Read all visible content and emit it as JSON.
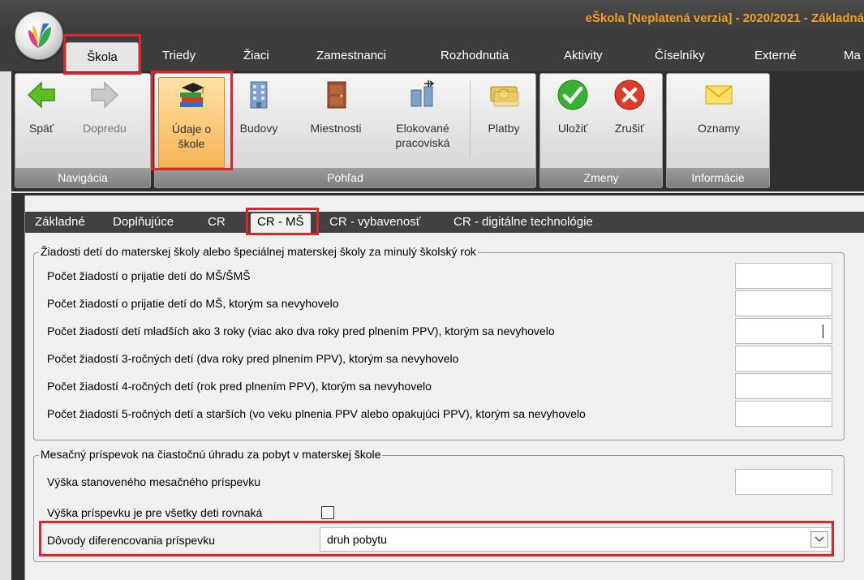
{
  "window": {
    "title": "eŠkola [Neplatená verzia] - 2020/2021 - Základná"
  },
  "ribbon_tabs": [
    "Škola",
    "Triedy",
    "Žiaci",
    "Zamestnanci",
    "Rozhodnutia",
    "Aktivity",
    "Číselníky",
    "Externé",
    "Ma"
  ],
  "ribbon": {
    "navigacia": {
      "label": "Navigácia",
      "back": "Späť",
      "forward": "Dopredu"
    },
    "pohlad": {
      "label": "Pohľad",
      "udaje_line1": "Údaje o",
      "udaje_line2": "škole",
      "budovy": "Budovy",
      "miestnosti": "Miestnosti",
      "elokovane_line1": "Elokované",
      "elokovane_line2": "pracoviská",
      "platby": "Platby"
    },
    "zmeny": {
      "label": "Zmeny",
      "save": "Uložiť",
      "cancel": "Zrušiť"
    },
    "informacie": {
      "label": "Informácie",
      "oznamy": "Oznamy"
    }
  },
  "subtabs": [
    "Základné",
    "Doplňujúce",
    "CR",
    "CR - MŠ",
    "CR - vybavenosť",
    "CR - digitálne technológie"
  ],
  "section1": {
    "legend": "Žiadosti detí do materskej školy alebo špeciálnej materskej školy za minulý školský rok",
    "rows": [
      "Počet žiadostí o prijatie detí do MŠ/ŠMŠ",
      "Počet žiadostí o prijatie detí do MŠ, ktorým sa nevyhovelo",
      "Počet žiadostí detí mladších ako 3 roky (viac ako dva roky pred plnením PPV), ktorým sa nevyhovelo",
      "Počet žiadostí 3-ročných detí (dva roky pred plnením PPV), ktorým sa nevyhovelo",
      "Počet žiadostí 4-ročných detí (rok pred plnením PPV), ktorým sa nevyhovelo",
      "Počet žiadostí 5-ročných detí a starších (vo veku plnenia PPV alebo opakujúci PPV), ktorým sa nevyhovelo"
    ]
  },
  "section2": {
    "legend": "Mesačný príspevok na čiastočnú úhradu za pobyt v materskej škole",
    "amount_label": "Výška stanoveného mesačného príspevku",
    "equal_label": "Výška príspevku je pre všetky deti rovnaká",
    "reason_label": "Dôvody diferencovania príspevku",
    "reason_value": "druh pobytu"
  }
}
